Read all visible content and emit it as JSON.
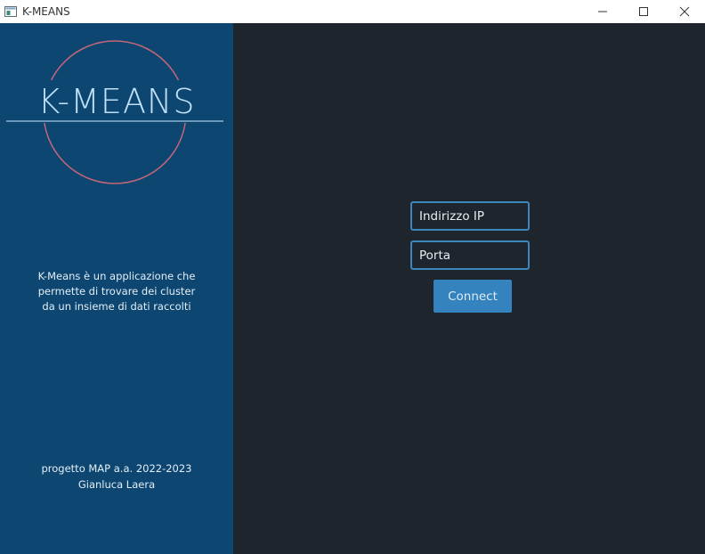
{
  "window": {
    "title": "K-MEANS",
    "app_icon": "window-app-icon",
    "controls": [
      "minimize-icon",
      "maximize-icon",
      "close-icon"
    ]
  },
  "left_panel": {
    "logo_text": "K-MEANS",
    "description_lines": [
      "K-Means è un applicazione che",
      "permette di trovare dei cluster",
      "da un insieme di dati raccolti"
    ],
    "credits_lines": [
      "progetto MAP a.a. 2022-2023",
      "Gianluca Laera"
    ]
  },
  "form": {
    "ip_placeholder": "Indirizzo IP",
    "port_placeholder": "Porta",
    "connect_label": "Connect"
  },
  "colors": {
    "left_panel_bg": "#0d4671",
    "right_panel_bg": "#1e252d",
    "accent": "#3482be",
    "logo_circle": "#c2667a",
    "logo_text": "#bfe0f7"
  }
}
